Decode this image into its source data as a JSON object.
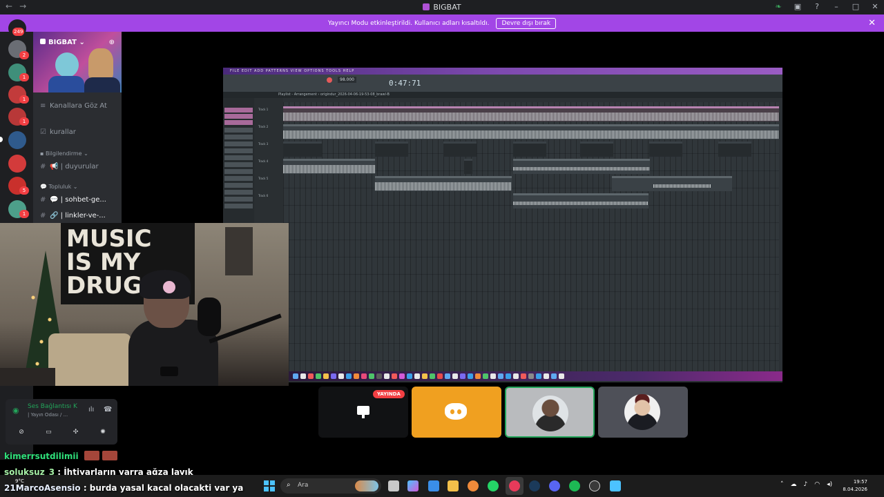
{
  "window": {
    "title": "BIGBAT"
  },
  "notice": {
    "text": "Yayıncı Modu etkinleştirildi. Kullanıcı adları kısaltıldı.",
    "button": "Devre dışı bırak"
  },
  "rail": {
    "badge_top": "249",
    "badges": [
      "2",
      "1",
      "1",
      "1",
      "1",
      "5",
      "1"
    ]
  },
  "server": {
    "name": "BIGBAT ⌄",
    "browse_channels": "Kanallara Göz At",
    "rules": "kurallar",
    "category_info": "Bilgilendirme",
    "announcements": "| duyurular",
    "category_community": "Topluluk",
    "chat_channel": "| sohbet-ge...",
    "links_channel": "| linkler-ve-..."
  },
  "voice": {
    "status": "Ses Bağlantısı K",
    "channel": "| Yayın Odası / ..."
  },
  "fl": {
    "menu": "FILE EDIT ADD PATTERNS VIEW OPTIONS TOOLS HELP",
    "time": "0:47:71",
    "tempo": "98.000",
    "playlist_title": "Playlist - Arrangement › origindur_2026-04-06-19-53-08_brawl-B",
    "tracks": [
      "Track 1",
      "Track 2",
      "Track 3",
      "Track 4",
      "Track 5",
      "Track 6"
    ]
  },
  "stream": {
    "live_badge": "YAYINDA"
  },
  "chat": [
    {
      "user": "kimerrsutdilimii",
      "text": ""
    },
    {
      "user": "soluksuz_3",
      "text": ": İhtiyarların yarra ağza layık"
    },
    {
      "user": "21MarcoAsensio",
      "text": ": burda yasal kacal olacakti var ya"
    }
  ],
  "taskbar": {
    "weather": "9°C",
    "search_placeholder": "Ara",
    "time": "19:57",
    "date": "8.04.2026"
  },
  "colors": {
    "accent": "#a246e6",
    "live": "#f23f43",
    "online": "#23a55a",
    "gold": "#f0a020"
  }
}
